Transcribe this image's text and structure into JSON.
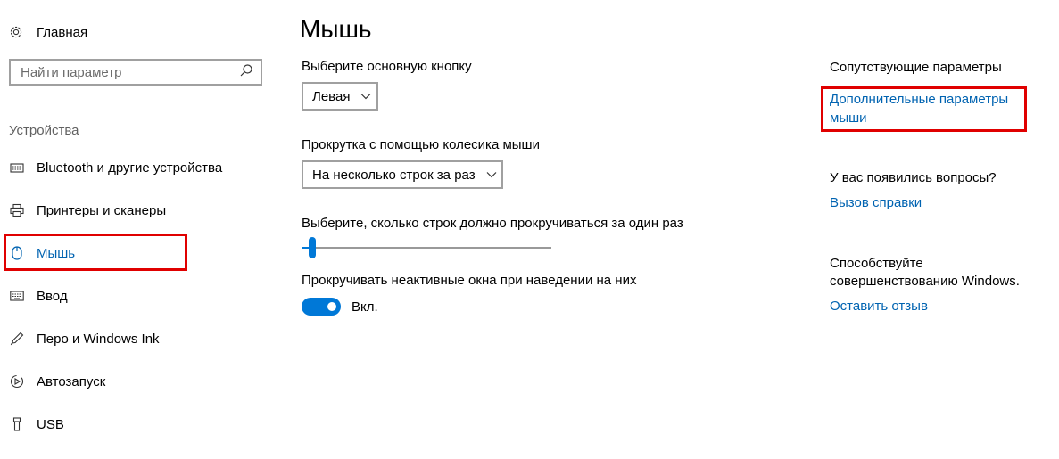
{
  "sidebar": {
    "home_label": "Главная",
    "search": {
      "placeholder": "Найти параметр"
    },
    "section_label": "Устройства",
    "items": [
      {
        "label": "Bluetooth и другие устройства",
        "icon": "keyboard-device-icon"
      },
      {
        "label": "Принтеры и сканеры",
        "icon": "printer-icon"
      },
      {
        "label": "Мышь",
        "icon": "mouse-icon",
        "active": true
      },
      {
        "label": "Ввод",
        "icon": "keyboard-icon"
      },
      {
        "label": "Перо и Windows Ink",
        "icon": "pen-icon"
      },
      {
        "label": "Автозапуск",
        "icon": "autoplay-icon"
      },
      {
        "label": "USB",
        "icon": "usb-icon"
      }
    ]
  },
  "main": {
    "title": "Мышь",
    "primary_button": {
      "label": "Выберите основную кнопку",
      "value": "Левая"
    },
    "scroll_wheel": {
      "label": "Прокрутка с помощью колесика мыши",
      "value": "На несколько строк за раз"
    },
    "lines_to_scroll": {
      "label": "Выберите, сколько строк должно прокручиваться за один раз",
      "level": 0.03
    },
    "inactive_scroll": {
      "label": "Прокручивать неактивные окна при наведении на них",
      "state": "Вкл."
    }
  },
  "related": {
    "heading": "Сопутствующие параметры",
    "link_line1": "Дополнительные параметры",
    "link_line2": "мыши",
    "questions_heading": "У вас появились вопросы?",
    "help_link": "Вызов справки",
    "feedback_line1": "Способствуйте",
    "feedback_line2": "совершенствованию Windows.",
    "feedback_link": "Оставить отзыв"
  },
  "colors": {
    "accent": "#0078d7",
    "link": "#0063b1",
    "highlight": "#e00000"
  }
}
